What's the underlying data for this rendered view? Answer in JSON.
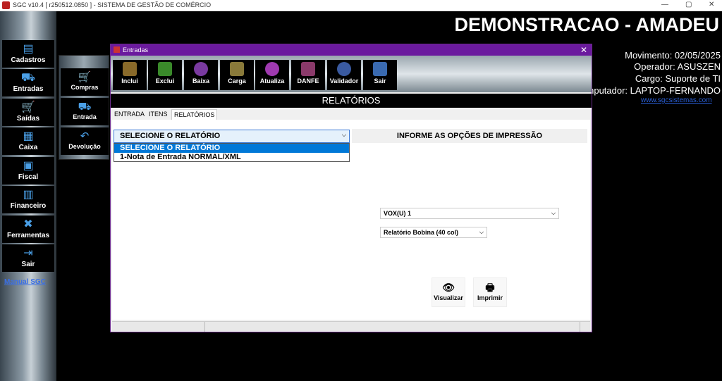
{
  "window": {
    "title": "SGC v10.4 [ r250512.0850 ] - SISTEMA DE GESTÃO DE COMÉRCIO",
    "controls": [
      "—",
      "▢",
      "✕"
    ]
  },
  "sidebar": {
    "items": [
      {
        "label": "Cadastros",
        "icon": "▤"
      },
      {
        "label": "Entradas",
        "icon": "⛟"
      },
      {
        "label": "Saídas",
        "icon": "🛒"
      },
      {
        "label": "Caixa",
        "icon": "▦"
      },
      {
        "label": "Fiscal",
        "icon": "▣"
      },
      {
        "label": "Financeiro",
        "icon": "▥"
      },
      {
        "label": "Ferramentas",
        "icon": "✖"
      },
      {
        "label": "Sair",
        "icon": "⇥"
      }
    ],
    "manual_link": "Manual SGC"
  },
  "subpanel": {
    "items": [
      {
        "label": "Compras",
        "icon": "🛒"
      },
      {
        "label": "Entrada",
        "icon": "⛟"
      },
      {
        "label": "Devolução",
        "icon": "↶"
      }
    ]
  },
  "banner": {
    "title": "DEMONSTRACAO - AMADEU",
    "movimento": "Movimento: 02/05/2025",
    "operador": "Operador: ASUSZEN",
    "cargo": "Cargo: Suporte de TI",
    "computador": "nputador: LAPTOP-FERNANDO",
    "site": "www.sgcsistemas.com"
  },
  "dialog": {
    "title": "Entradas",
    "close": "✕",
    "toolbar": [
      {
        "label": "Inclui",
        "color": "#8a6a2a"
      },
      {
        "label": "Exclui",
        "color": "#3a8a2a"
      },
      {
        "label": "Baixa",
        "color": "#7a3aa0"
      },
      {
        "label": "Carga",
        "color": "#8a7a3a"
      },
      {
        "label": "Atualiza",
        "color": "#a03ab0"
      },
      {
        "label": "DANFE",
        "color": "#8a3a6a"
      },
      {
        "label": "Validador",
        "color": "#3a5aa0"
      },
      {
        "label": "Sair",
        "color": "#3a6ab0"
      }
    ],
    "header": "RELATÓRIOS",
    "tabs": [
      "ENTRADA",
      "ITENS",
      "RELATÓRIOS"
    ],
    "report_select": {
      "value": "SELECIONE O RELATÓRIO",
      "options": [
        "SELECIONE O RELATÓRIO",
        "1-Nota de Entrada NORMAL/XML"
      ]
    },
    "print_options_header": "INFORME AS OPÇÕES DE IMPRESSÃO",
    "printer_select": "VOX(U) 1",
    "format_select": "Relatório Bobina (40 col)",
    "buttons": {
      "preview": "Visualizar",
      "print": "Imprimir"
    }
  }
}
